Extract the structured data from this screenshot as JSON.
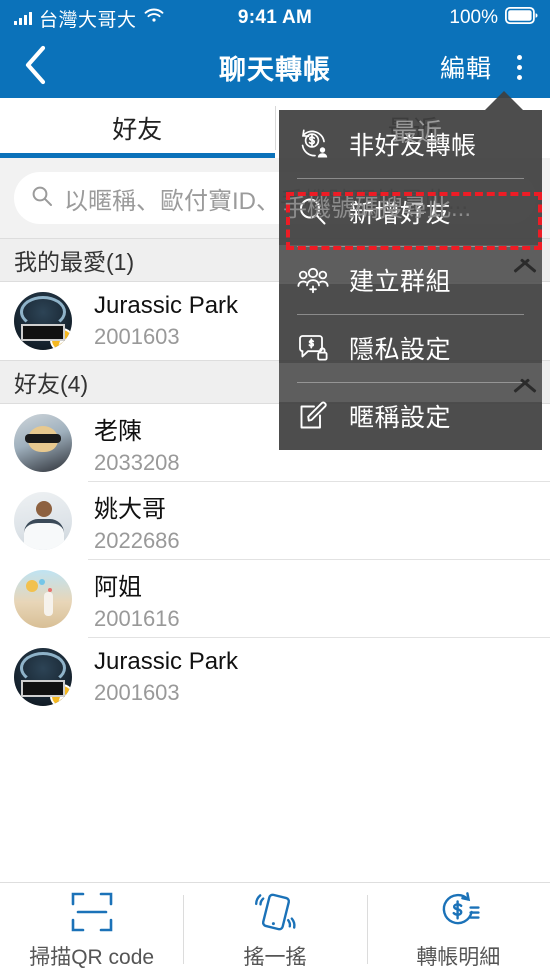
{
  "status_bar": {
    "carrier": "台灣大哥大",
    "time": "9:41 AM",
    "battery": "100%",
    "signal_icon": "signal-bars-icon",
    "wifi_icon": "wifi-icon",
    "battery_icon": "battery-full-icon"
  },
  "header": {
    "title": "聊天轉帳",
    "back_icon": "chevron-left-icon",
    "edit_label": "編輯",
    "kebab_icon": "more-vertical-icon"
  },
  "tabs": [
    {
      "label": "好友",
      "active": true
    },
    {
      "label": "最近",
      "active": false
    }
  ],
  "search": {
    "placeholder": "以暱稱、歐付寶ID、手機號碼搜尋此...",
    "value": "",
    "icon": "search-icon"
  },
  "sections": [
    {
      "title": "我的最愛(1)",
      "rows": [
        {
          "name": "Jurassic Park",
          "id": "2001603",
          "avatar": "av-jp",
          "favorite": true
        }
      ]
    },
    {
      "title": "好友(4)",
      "rows": [
        {
          "name": "老陳",
          "id": "2033208",
          "avatar": "av-lady",
          "favorite": false
        },
        {
          "name": "姚大哥",
          "id": "2022686",
          "avatar": "av-man",
          "favorite": false
        },
        {
          "name": "阿姐",
          "id": "2001616",
          "avatar": "av-beach",
          "favorite": false
        },
        {
          "name": "Jurassic Park",
          "id": "2001603",
          "avatar": "av-jp",
          "favorite": true
        }
      ]
    }
  ],
  "menu": {
    "items": [
      {
        "label": "非好友轉帳",
        "icon": "transfer-nonfriend-icon"
      },
      {
        "label": "新增好友",
        "icon": "search-add-friend-icon",
        "highlighted": true
      },
      {
        "label": "建立群組",
        "icon": "group-add-icon"
      },
      {
        "label": "隱私設定",
        "icon": "privacy-lock-icon"
      },
      {
        "label": "暱稱設定",
        "icon": "edit-pencil-icon"
      }
    ]
  },
  "bottom_bar": [
    {
      "label": "掃描QR code",
      "icon": "qr-scan-icon"
    },
    {
      "label": "搖一搖",
      "icon": "shake-phone-icon"
    },
    {
      "label": "轉帳明細",
      "icon": "transfer-history-icon"
    }
  ],
  "colors": {
    "brand_blue": "#0b72ba",
    "menu_bg": "#3f3f3f",
    "highlight_red": "#ee1c25",
    "star_gold": "#f5b821"
  }
}
